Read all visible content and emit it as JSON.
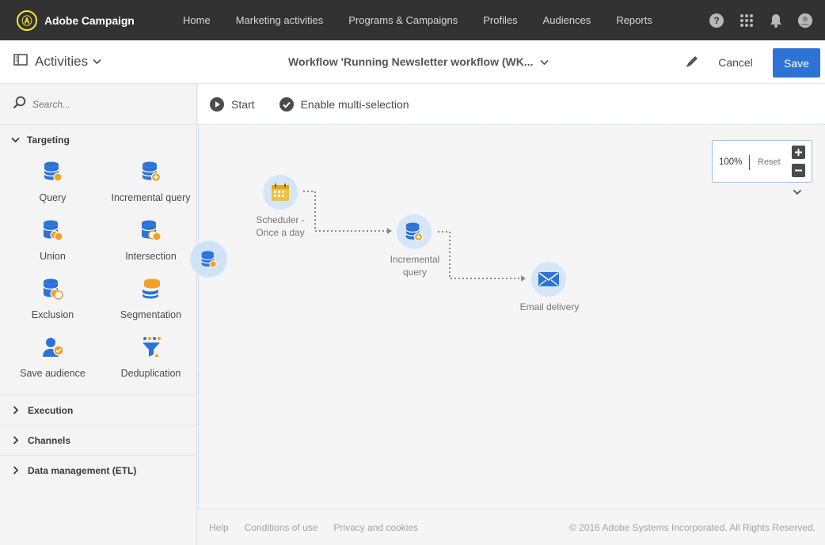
{
  "app": {
    "brand": "Adobe Campaign",
    "brand_glyph": "Ⓐ",
    "nav": [
      "Home",
      "Marketing activities",
      "Programs & Campaigns",
      "Profiles",
      "Audiences",
      "Reports"
    ],
    "icons": [
      "help-icon",
      "apps-grid-icon",
      "bell-icon",
      "user-avatar-icon"
    ]
  },
  "header": {
    "panel_label": "Activities",
    "workflow_title": "Workflow 'Running Newsletter workflow (WK...",
    "cancel_label": "Cancel",
    "save_label": "Save"
  },
  "sidebar": {
    "search_placeholder": "Search...",
    "sections": {
      "targeting": "Targeting",
      "execution": "Execution",
      "channels": "Channels",
      "etl": "Data management (ETL)"
    },
    "targeting_items": [
      "Query",
      "Incremental query",
      "Union",
      "Intersection",
      "Exclusion",
      "Segmentation",
      "Save audience",
      "Deduplication"
    ]
  },
  "toolbar": {
    "start_label": "Start",
    "multiselect_label": "Enable multi-selection"
  },
  "canvas": {
    "zoom": "100%",
    "reset_label": "Reset",
    "nodes": {
      "scheduler": [
        "Scheduler -",
        "Once a day"
      ],
      "incremental": [
        "Incremental",
        "query"
      ],
      "email": "Email delivery"
    }
  },
  "footer": {
    "help": "Help",
    "conditions": "Conditions of use",
    "privacy": "Privacy and cookies",
    "copyright": "© 2016 Adobe Systems Incorporated. All Rights Reserved."
  },
  "colors": {
    "topbar": "#323232",
    "primary_button": "#2d73d6",
    "icon_blue": "#2d73d6",
    "icon_orange": "#f0a02a",
    "node_fill": "#d6e6f7"
  }
}
